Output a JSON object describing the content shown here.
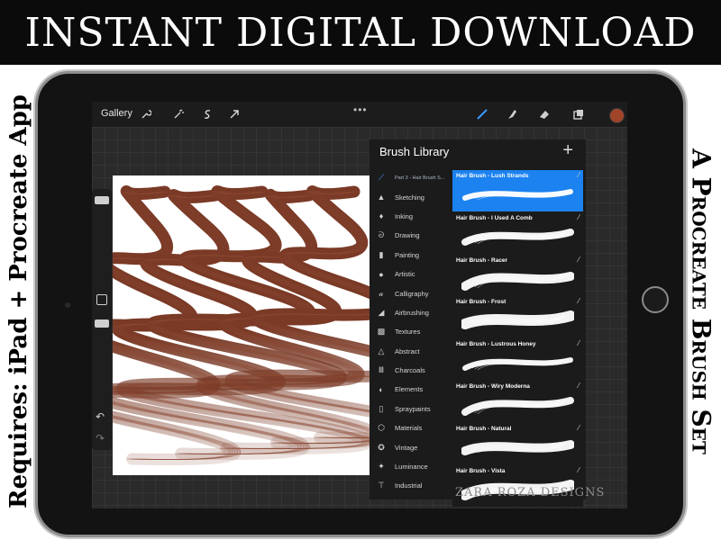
{
  "banner": {
    "title": "INSTANT DIGITAL DOWNLOAD"
  },
  "side_left": {
    "text": "Requires: iPad + Procreate App"
  },
  "side_right": {
    "text": "A Procreate Brush Set"
  },
  "topbar": {
    "gallery_label": "Gallery",
    "dots": "•••",
    "tools_left": [
      "wrench-icon",
      "magic-wand-icon",
      "selection-icon",
      "transform-arrow-icon"
    ],
    "tools_right": [
      "brush-icon",
      "smudge-icon",
      "eraser-icon",
      "layers-icon"
    ],
    "current_color": "#a0452a"
  },
  "brush_library": {
    "title": "Brush Library",
    "plus": "+",
    "categories": [
      {
        "label": "Part 3 - Hair Brush S...",
        "icon": "brush-stroke-icon",
        "active": true
      },
      {
        "label": "Sketching",
        "icon": "pencil-icon"
      },
      {
        "label": "Inking",
        "icon": "ink-drop-icon"
      },
      {
        "label": "Drawing",
        "icon": "squiggle-icon"
      },
      {
        "label": "Painting",
        "icon": "paint-brush-icon"
      },
      {
        "label": "Artistic",
        "icon": "palette-icon"
      },
      {
        "label": "Calligraphy",
        "icon": "calligraphy-icon"
      },
      {
        "label": "Airbrushing",
        "icon": "airbrush-icon"
      },
      {
        "label": "Textures",
        "icon": "texture-icon"
      },
      {
        "label": "Abstract",
        "icon": "triangle-icon"
      },
      {
        "label": "Charcoals",
        "icon": "charcoal-icon"
      },
      {
        "label": "Elements",
        "icon": "yin-yang-icon"
      },
      {
        "label": "Spraypaints",
        "icon": "spray-can-icon"
      },
      {
        "label": "Materials",
        "icon": "cube-icon"
      },
      {
        "label": "Vintage",
        "icon": "star-badge-icon"
      },
      {
        "label": "Luminance",
        "icon": "sparkle-icon"
      },
      {
        "label": "Industrial",
        "icon": "anvil-icon"
      }
    ],
    "brushes": [
      {
        "name": "Hair Brush - Lush Strands",
        "active": true
      },
      {
        "name": "Hair Brush - I Used A Comb"
      },
      {
        "name": "Hair Brush - Racer"
      },
      {
        "name": "Hair Brush - Frost"
      },
      {
        "name": "Hair Brush - Lustrous Honey"
      },
      {
        "name": "Hair Brush - Wiry Moderna"
      },
      {
        "name": "Hair Brush - Natural"
      },
      {
        "name": "Hair Brush - Vista"
      }
    ]
  },
  "canvas": {
    "stroke_color": "#7a3a26"
  },
  "watermark": "ZARA ROZA DESIGNS"
}
